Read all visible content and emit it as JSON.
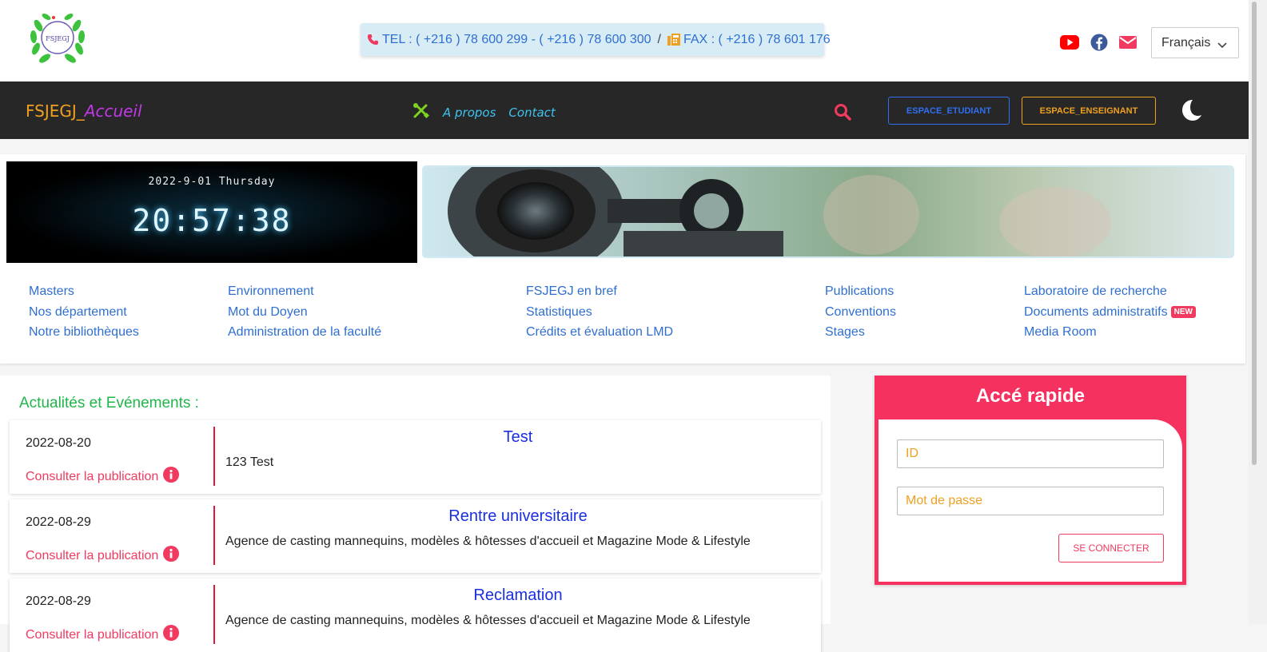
{
  "header": {
    "logo_text": "FSJEGJ",
    "tel_label": "TEL : ( +216 ) 78 600 299 - ( +216 ) 78 600 300",
    "separator": "/",
    "fax_label": "FAX : ( +216 ) 78 601 176",
    "language": "Français"
  },
  "navbar": {
    "brand_part1": "FSJEGJ_",
    "brand_part2": "Accueil",
    "about": "A propos",
    "contact": "Contact",
    "btn_student": "ESPACE_ETUDIANT",
    "btn_teacher": "ESPACE_ENSEIGNANT"
  },
  "clock": {
    "date": "2022-9-01 Thursday",
    "time": "20:57:38"
  },
  "links": {
    "col1": [
      "Masters",
      "Nos département",
      "Notre bibliothèques"
    ],
    "col2": [
      "Environnement",
      "Mot du Doyen",
      "Administration de la faculté"
    ],
    "col3": [
      "FSJEGJ en bref",
      "Statistiques",
      "Crédits et évaluation LMD"
    ],
    "col4": [
      "Publications",
      "Conventions",
      "Stages"
    ],
    "col5": [
      "Laboratoire de recherche",
      "Documents administratifs",
      "Media Room"
    ],
    "new_badge": "NEW"
  },
  "news": {
    "title": "Actualités et Evénements :",
    "consult_label": "Consulter la publication",
    "items": [
      {
        "date": "2022-08-20",
        "title": "Test",
        "desc": "123 Test"
      },
      {
        "date": "2022-08-29",
        "title": "Rentre universitaire",
        "desc": "Agence de casting mannequins, modèles & hôtesses d'accueil et Magazine Mode & Lifestyle"
      },
      {
        "date": "2022-08-29",
        "title": "Reclamation",
        "desc": "Agence de casting mannequins, modèles & hôtesses d'accueil et Magazine Mode & Lifestyle"
      }
    ]
  },
  "quick_access": {
    "title": "Accé rapide",
    "id_placeholder": "ID",
    "password_placeholder": "Mot de passe",
    "connect_label": "SE CONNECTER"
  },
  "colors": {
    "accent_red": "#f03a5f",
    "link_blue": "#2f6fd0",
    "news_green": "#1fb64a",
    "navbar_bg": "#272727"
  }
}
